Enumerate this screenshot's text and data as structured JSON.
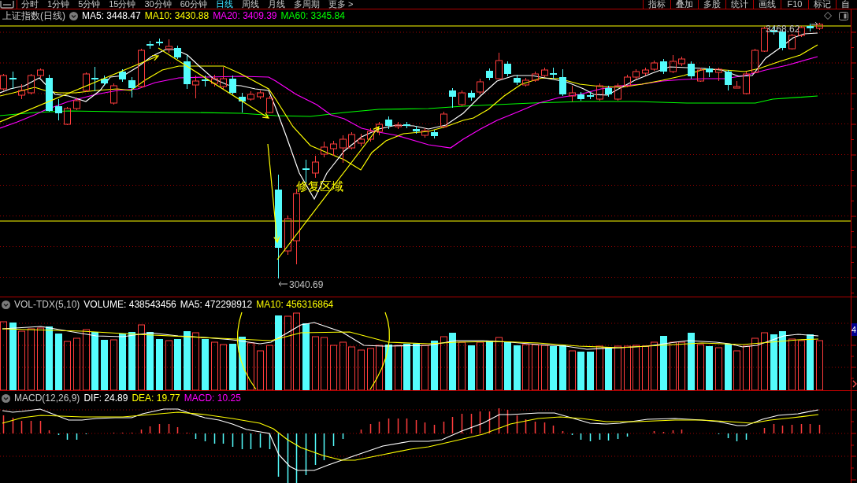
{
  "toolbar": {
    "periods": [
      {
        "label": "分时",
        "selected": false
      },
      {
        "label": "1分钟",
        "selected": false
      },
      {
        "label": "5分钟",
        "selected": false
      },
      {
        "label": "15分钟",
        "selected": false
      },
      {
        "label": "30分钟",
        "selected": false
      },
      {
        "label": "60分钟",
        "selected": false
      },
      {
        "label": "日线",
        "selected": true
      },
      {
        "label": "周线",
        "selected": false
      },
      {
        "label": "月线",
        "selected": false
      },
      {
        "label": "多周期",
        "selected": false
      },
      {
        "label": "更多 >",
        "selected": false
      }
    ],
    "tools": [
      "指标",
      "叠加",
      "多股",
      "统计",
      "画线",
      "F10",
      "标记",
      "自"
    ]
  },
  "price_pane": {
    "title": "上证指数(日线)",
    "indicators": [
      {
        "label": "MA5: 3448.47",
        "color": "#ffffff"
      },
      {
        "label": "MA10: 3430.88",
        "color": "#ffff00"
      },
      {
        "label": "MA20: 3409.39",
        "color": "#ff00ff"
      },
      {
        "label": "MA60: 3345.84",
        "color": "#00ff00"
      }
    ],
    "high_label": "3468.62",
    "low_label": "3040.69",
    "annotation": "修复区域"
  },
  "volume_pane": {
    "title": "VOL-TDX(5,10)",
    "indicators": [
      {
        "label": "VOLUME: 438543456",
        "color": "#ffffff"
      },
      {
        "label": "MA5: 472298912",
        "color": "#ffffff"
      },
      {
        "label": "MA10: 456316864",
        "color": "#ffff00"
      }
    ],
    "axis_label": "4"
  },
  "macd_pane": {
    "title": "MACD(12,26,9)",
    "indicators": [
      {
        "label": "DIF: 24.89",
        "color": "#ffffff"
      },
      {
        "label": "DEA: 19.77",
        "color": "#ffff00"
      },
      {
        "label": "MACD: 10.25",
        "color": "#ff00ff"
      }
    ]
  }
}
